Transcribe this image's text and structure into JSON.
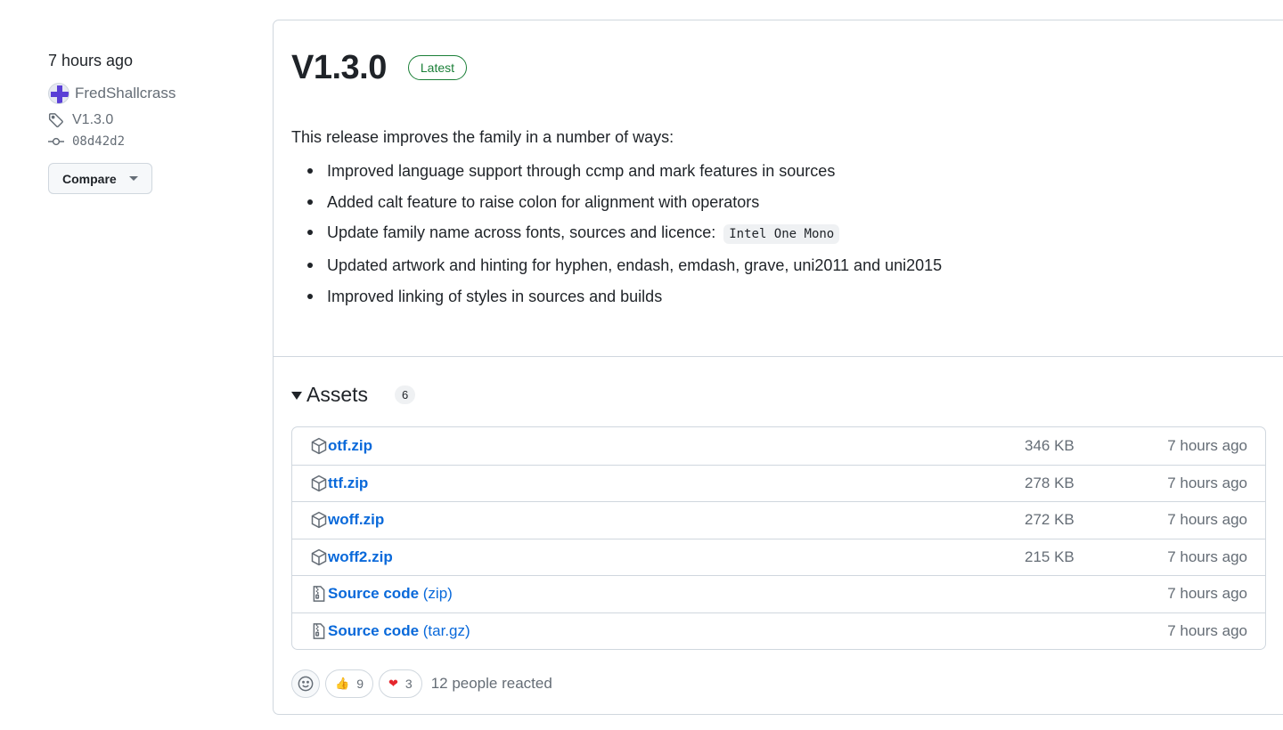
{
  "meta": {
    "time": "7 hours ago",
    "author": "FredShallcrass",
    "tag": "V1.3.0",
    "commit": "08d42d2",
    "compare_label": "Compare"
  },
  "release": {
    "title": "V1.3.0",
    "badge": "Latest",
    "intro": "This release improves the family in a number of ways:",
    "notes": [
      "Improved language support through ccmp and mark features in sources",
      "Added calt feature to raise colon for alignment with operators",
      "Update family name across fonts, sources and licence:",
      "Updated artwork and hinting for hyphen, endash, emdash, grave, uni2011 and uni2015",
      "Improved linking of styles in sources and builds"
    ],
    "note_code": "Intel One Mono"
  },
  "assets": {
    "title": "Assets",
    "count": "6",
    "items": [
      {
        "name": "otf.zip",
        "ext": "",
        "size": "346 KB",
        "time": "7 hours ago",
        "icon": "package-icon"
      },
      {
        "name": "ttf.zip",
        "ext": "",
        "size": "278 KB",
        "time": "7 hours ago",
        "icon": "package-icon"
      },
      {
        "name": "woff.zip",
        "ext": "",
        "size": "272 KB",
        "time": "7 hours ago",
        "icon": "package-icon"
      },
      {
        "name": "woff2.zip",
        "ext": "",
        "size": "215 KB",
        "time": "7 hours ago",
        "icon": "package-icon"
      },
      {
        "name": "Source code",
        "ext": " (zip)",
        "size": "",
        "time": "7 hours ago",
        "icon": "file-zip-icon"
      },
      {
        "name": "Source code",
        "ext": " (tar.gz)",
        "size": "",
        "time": "7 hours ago",
        "icon": "file-zip-icon"
      }
    ]
  },
  "reactions": {
    "thumbs_up": {
      "emoji": "👍",
      "count": "9"
    },
    "heart": {
      "emoji": "❤",
      "count": "3"
    },
    "summary": "12 people reacted"
  },
  "colors": {
    "link": "#0969da",
    "latest_green": "#1a7f37",
    "muted": "#656d76",
    "border": "#d0d7de"
  }
}
